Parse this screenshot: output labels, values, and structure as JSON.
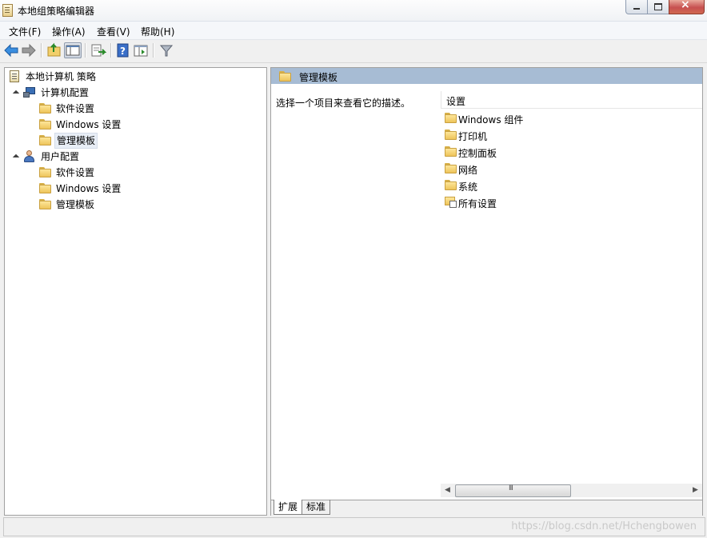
{
  "window": {
    "title": "本地组策略编辑器",
    "controls": {
      "minimize": "minimize",
      "maximize": "maximize",
      "close": "×"
    }
  },
  "menu": {
    "file": "文件(F)",
    "action": "操作(A)",
    "view": "查看(V)",
    "help": "帮助(H)"
  },
  "toolbar": {
    "icons": [
      "back-arrow-icon",
      "forward-arrow-icon",
      "up-folder-icon",
      "show-hide-tree-icon",
      "export-list-icon",
      "help-icon",
      "properties-icon",
      "filter-icon"
    ]
  },
  "tree": {
    "root": "本地计算机 策略",
    "computer_config": {
      "label": "计算机配置",
      "children": [
        "软件设置",
        "Windows 设置",
        "管理模板"
      ]
    },
    "user_config": {
      "label": "用户配置",
      "children": [
        "软件设置",
        "Windows 设置",
        "管理模板"
      ]
    },
    "selected": "管理模板"
  },
  "details": {
    "header_title": "管理模板",
    "description": "选择一个项目来查看它的描述。",
    "column_header": "设置",
    "items": [
      "Windows 组件",
      "打印机",
      "控制面板",
      "网络",
      "系统",
      "所有设置"
    ]
  },
  "scrollbar": {
    "left_arrow": "◀",
    "right_arrow": "▶",
    "grip": "III"
  },
  "tabs": {
    "extended": "扩展",
    "standard": "标准"
  },
  "watermark": "https://blog.csdn.net/Hchengbowen",
  "colors": {
    "header_bar": "#a7bcd4",
    "selection": "#e8eef6",
    "close_button": "#c75050"
  }
}
